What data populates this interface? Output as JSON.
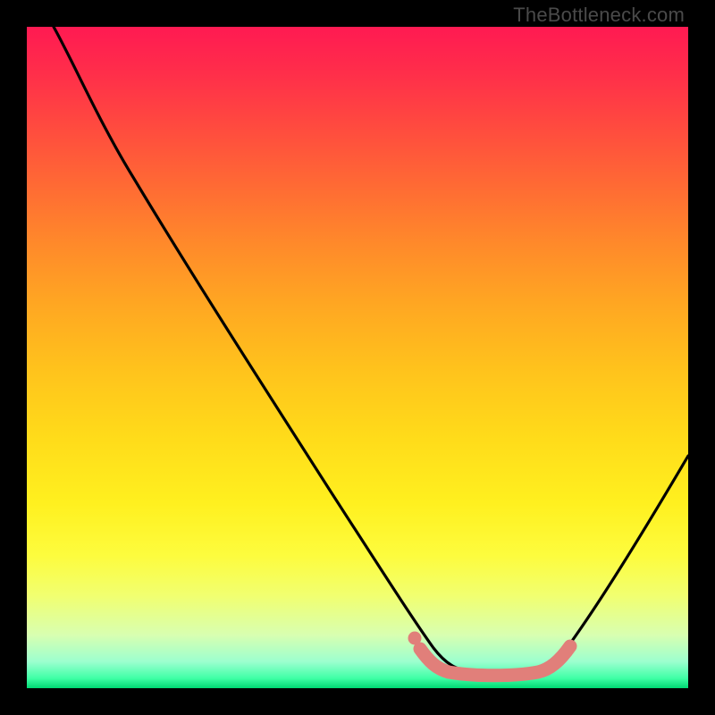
{
  "watermark": "TheBottleneck.com",
  "chart_data": {
    "type": "line",
    "title": "",
    "xlabel": "",
    "ylabel": "",
    "xlim": [
      0,
      100
    ],
    "ylim": [
      0,
      100
    ],
    "series": [
      {
        "name": "bottleneck-curve",
        "x": [
          4,
          10,
          18,
          27,
          36,
          45,
          54,
          58,
          62,
          66,
          70,
          74,
          78,
          82,
          88,
          94,
          100
        ],
        "y": [
          100,
          90,
          78,
          64,
          50,
          36,
          22,
          16,
          10,
          6,
          4,
          3.5,
          3.5,
          5,
          14,
          28,
          44
        ]
      }
    ],
    "highlight_band": {
      "x_start": 60,
      "x_end": 82,
      "color": "#e17f7a"
    },
    "colors": {
      "curve": "#000000",
      "frame": "#000000",
      "highlight": "#e17f7a"
    }
  }
}
